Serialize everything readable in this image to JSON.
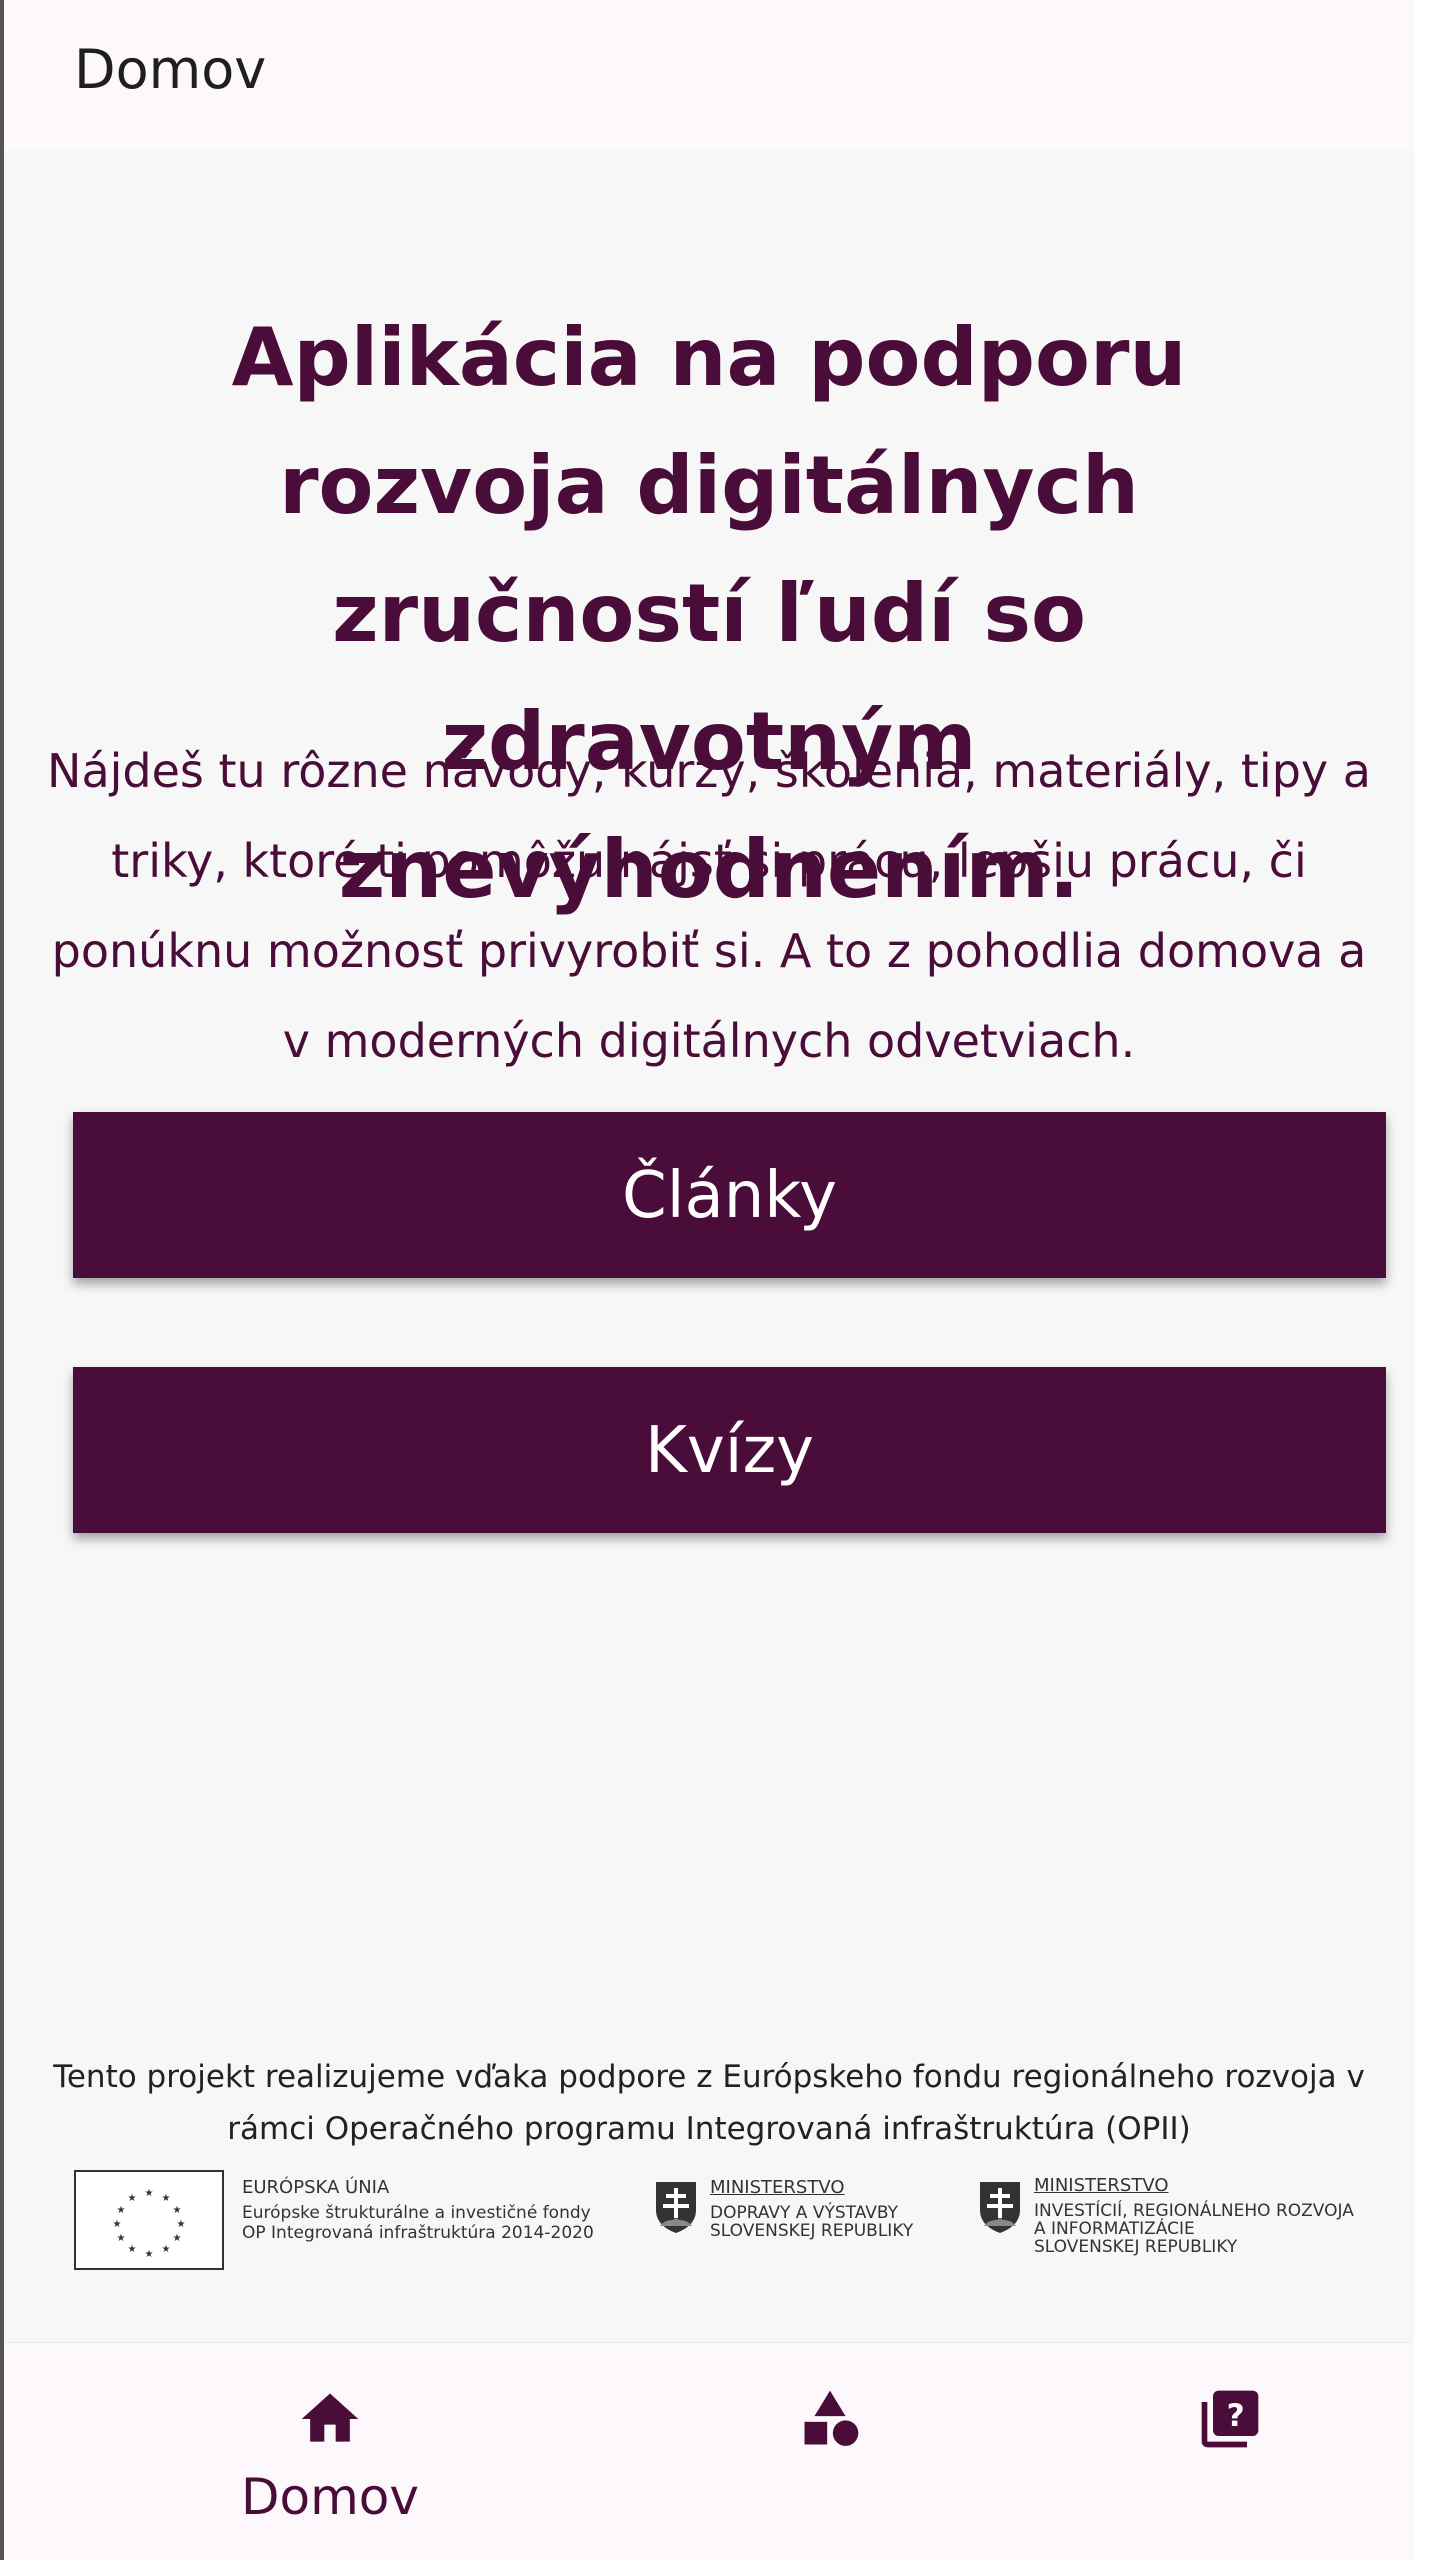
{
  "app_bar": {
    "title": "Domov"
  },
  "main": {
    "headline": "Aplikácia na podporu rozvoja digitálnych zručností ľudí so zdravotným znevýhodnením.",
    "description": "Nájdeš tu rôzne návody, kurzy, školenia, materiály, tipy a triky, ktoré ti pomôžu nájsť si prácu, lepšiu prácu, či ponúknu možnosť privyrobiť si. A to z pohodlia domova a v moderných digitálnych odvetviach.",
    "buttons": {
      "articles": "Články",
      "quizzes": "Kvízy"
    }
  },
  "footer": {
    "funding_text": "Tento projekt realizujeme vďaka podpore z Európskeho fondu regionálneho rozvoja v rámci Operačného programu Integrovaná infraštruktúra (OPII)",
    "logos": {
      "eu": {
        "title": "EURÓPSKA ÚNIA",
        "line1": "Európske štrukturálne a investičné fondy",
        "line2": "OP Integrovaná infraštruktúra 2014-2020"
      },
      "ministry_transport": {
        "title": "MINISTERSTVO",
        "line1": "DOPRAVY A VÝSTAVBY",
        "line2": "SLOVENSKEJ REPUBLIKY"
      },
      "ministry_investments": {
        "title": "MINISTERSTVO",
        "line1": "INVESTÍCIÍ, REGIONÁLNEHO ROZVOJA",
        "line2": "A INFORMATIZÁCIE",
        "line3": "SLOVENSKEJ REPUBLIKY"
      }
    }
  },
  "bottom_nav": {
    "active_color": "#4a0c38",
    "items": [
      {
        "icon": "home-icon",
        "label": "Domov",
        "active": true
      },
      {
        "icon": "shapes-icon",
        "label": "",
        "active": false
      },
      {
        "icon": "quiz-icon",
        "label": "",
        "active": false
      }
    ]
  },
  "colors": {
    "primary": "#4a0c38",
    "background": "#f7f7f7",
    "bar_background": "#fcf8fb"
  }
}
